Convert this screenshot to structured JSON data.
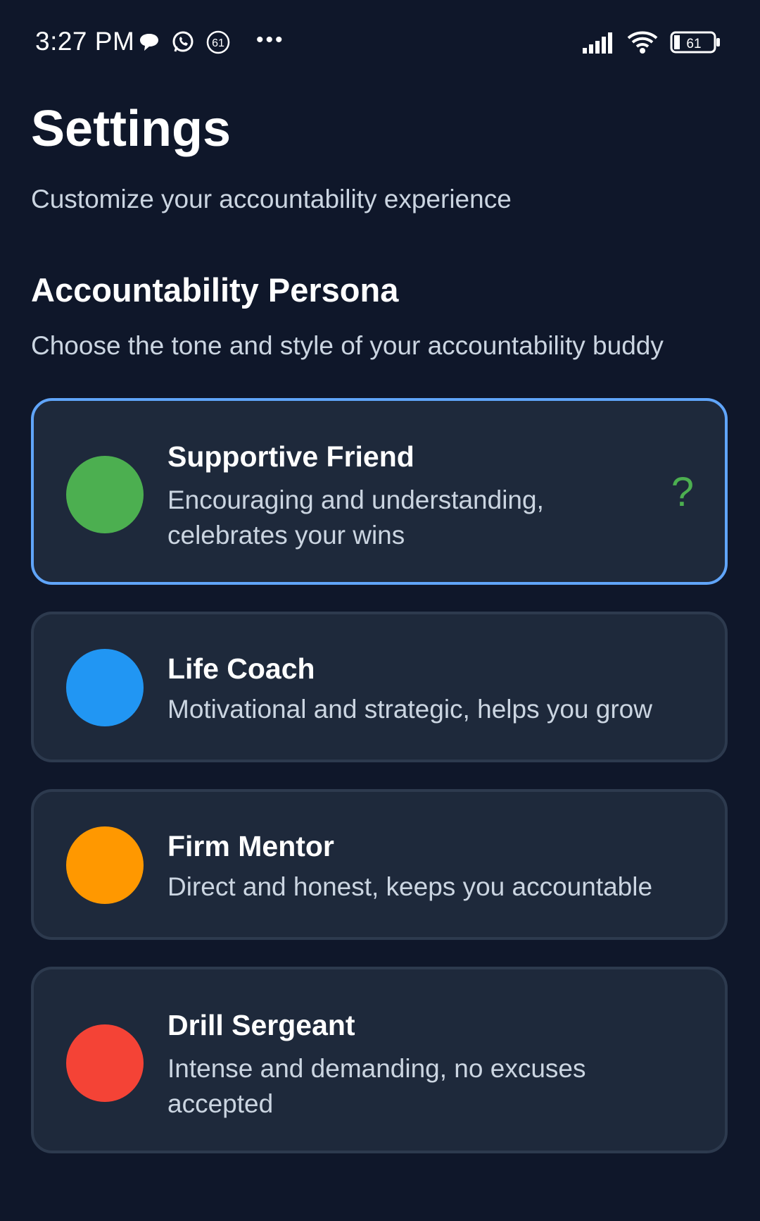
{
  "status_bar": {
    "time": "3:27 PM",
    "notification_count": "61",
    "battery_level": "61",
    "icons": [
      "chat-bubble-icon",
      "whatsapp-icon",
      "notification-count-icon",
      "more-dots-icon",
      "signal-icon",
      "wifi-icon",
      "battery-icon"
    ]
  },
  "header": {
    "title": "Settings",
    "subtitle": "Customize your accountability experience"
  },
  "section": {
    "title": "Accountability Persona",
    "description": "Choose the tone and style of your accountability buddy"
  },
  "personas": [
    {
      "name": "Supportive Friend",
      "description": "Encouraging and understanding, celebrates your wins",
      "color": "#4caf50",
      "selected": true,
      "selected_indicator": "?"
    },
    {
      "name": "Life Coach",
      "description": "Motivational and strategic, helps you grow",
      "color": "#2196f3",
      "selected": false
    },
    {
      "name": "Firm Mentor",
      "description": "Direct and honest, keeps you accountable",
      "color": "#ff9800",
      "selected": false
    },
    {
      "name": "Drill Sergeant",
      "description": "Intense and demanding, no excuses accepted",
      "color": "#f44336",
      "selected": false
    }
  ],
  "colors": {
    "background": "#0f172a",
    "card": "#1e293b",
    "selected_border": "#60a5fa"
  }
}
